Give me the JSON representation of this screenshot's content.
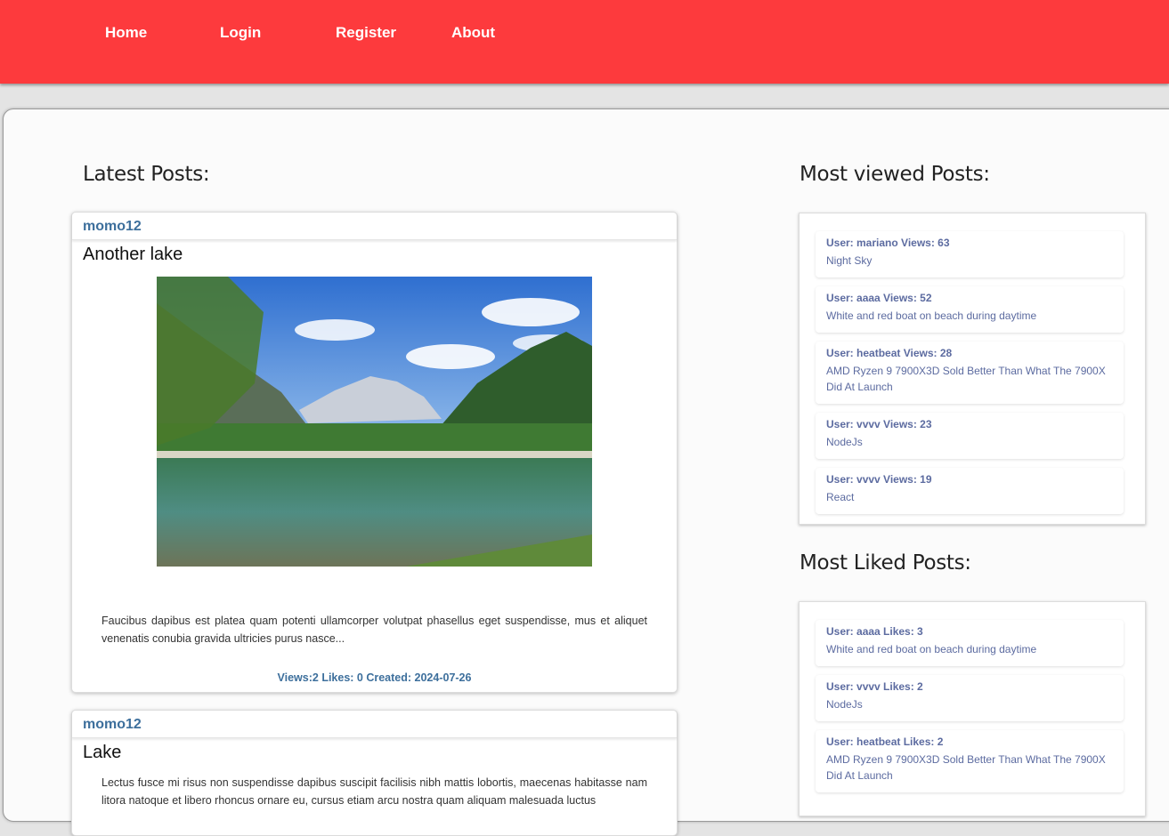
{
  "nav": {
    "items": [
      {
        "label": "Home"
      },
      {
        "label": "Login"
      },
      {
        "label": "Register"
      },
      {
        "label": "About"
      }
    ]
  },
  "latest": {
    "heading": "Latest Posts:",
    "posts": [
      {
        "author": "momo12",
        "title": "Another lake",
        "image": "lake-mountains-photo",
        "excerpt": "Faucibus dapibus est platea quam potenti ullamcorper volutpat phasellus eget suspendisse, mus et aliquet venenatis conubia gravida ultricies purus nasce...",
        "meta": "Views:2 Likes: 0 Created: 2024-07-26"
      },
      {
        "author": "momo12",
        "title": "Lake",
        "excerpt": "Lectus fusce mi risus non suspendisse dapibus suscipit facilisis nibh mattis lobortis, maecenas habitasse nam litora natoque et libero rhoncus ornare eu, cursus etiam arcu nostra quam aliquam malesuada luctus"
      }
    ]
  },
  "most_viewed": {
    "heading": "Most viewed Posts:",
    "items": [
      {
        "head": "User: mariano Views: 63",
        "title": "Night Sky"
      },
      {
        "head": "User: aaaa Views: 52",
        "title": "White and red boat on beach during daytime"
      },
      {
        "head": "User: heatbeat Views: 28",
        "title": "AMD Ryzen 9 7900X3D Sold Better Than What The 7900X Did At Launch"
      },
      {
        "head": "User: vvvv Views: 23",
        "title": "NodeJs"
      },
      {
        "head": "User: vvvv Views: 19",
        "title": "React"
      }
    ]
  },
  "most_liked": {
    "heading": "Most Liked Posts:",
    "items": [
      {
        "head": "User: aaaa Likes: 3",
        "title": "White and red boat on beach during daytime"
      },
      {
        "head": "User: vvvv Likes: 2",
        "title": "NodeJs"
      },
      {
        "head": "User: heatbeat Likes: 2",
        "title": "AMD Ryzen 9 7900X3D Sold Better Than What The 7900X Did At Launch"
      }
    ]
  },
  "colors": {
    "nav_background": "#fd3a3d",
    "link_blue": "#3d6f9c",
    "side_text": "#5c6ba0"
  }
}
